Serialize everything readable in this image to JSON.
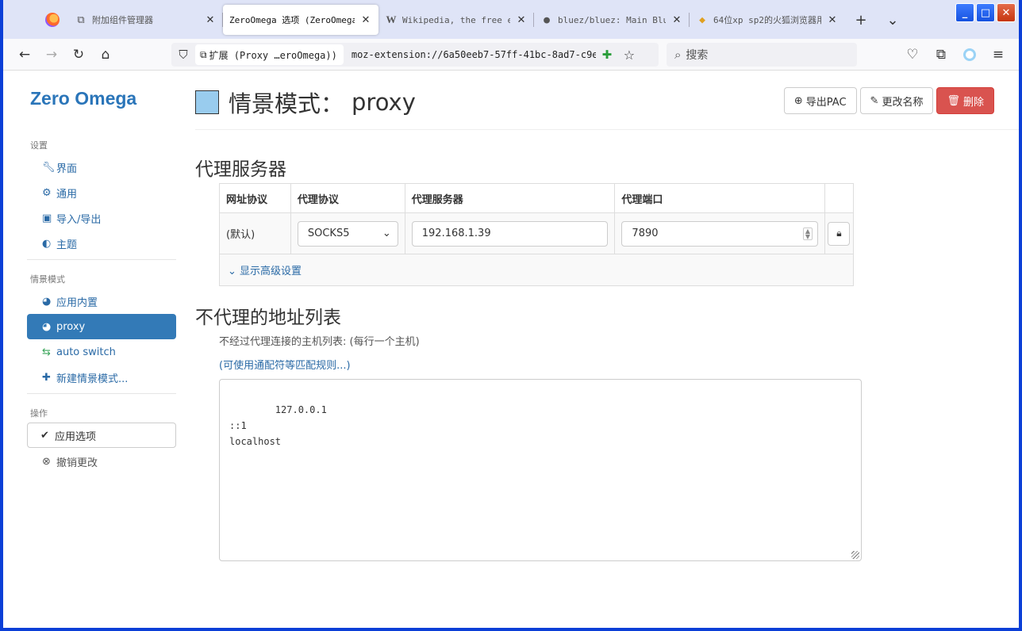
{
  "tabs": [
    {
      "icon": "puzzle-icon",
      "title": "附加组件管理器",
      "active": false
    },
    {
      "icon": "",
      "title": "ZeroOmega 选项 (ZeroOmega)",
      "active": true
    },
    {
      "icon": "wikipedia-icon",
      "title": "Wikipedia, the free enc",
      "active": false
    },
    {
      "icon": "github-icon",
      "title": "bluez/bluez: Main BlueZ",
      "active": false
    },
    {
      "icon": "fox-icon",
      "title": "64位xp sp2的火狐浏览器用",
      "active": false
    }
  ],
  "toolbar": {
    "extension_chip": "扩展 (Proxy …eroOmega))",
    "url": "moz-extension://6a50eeb7-57ff-41bc-8ad7-c9ed",
    "search_placeholder": "搜索"
  },
  "sidebar": {
    "brand": "Zero Omega",
    "section_settings": "设置",
    "settings_items": [
      {
        "icon": "wrench-icon",
        "label": "界面"
      },
      {
        "icon": "gear-icon",
        "label": "通用"
      },
      {
        "icon": "floppy-icon",
        "label": "导入/导出"
      },
      {
        "icon": "contrast-icon",
        "label": "主题"
      }
    ],
    "section_profiles": "情景模式",
    "profile_items": [
      {
        "icon": "globe-icon",
        "label": "应用内置",
        "active": false
      },
      {
        "icon": "globe-icon",
        "label": "proxy",
        "active": true
      },
      {
        "icon": "switch-icon",
        "label": "auto switch",
        "active": false
      },
      {
        "icon": "plus-icon",
        "label": "新建情景模式...",
        "active": false
      }
    ],
    "section_actions": "操作",
    "apply_label": "应用选项",
    "discard_label": "撤销更改"
  },
  "header": {
    "title_prefix": "情景模式：",
    "profile_name": "proxy",
    "export_pac": "导出PAC",
    "rename": "更改名称",
    "delete": "删除"
  },
  "proxy_section": {
    "heading": "代理服务器",
    "columns": [
      "网址协议",
      "代理协议",
      "代理服务器",
      "代理端口"
    ],
    "row": {
      "scheme": "(默认)",
      "protocol": "SOCKS5",
      "server": "192.168.1.39",
      "port": "7890"
    },
    "advanced_link": "显示高级设置"
  },
  "bypass_section": {
    "heading": "不代理的地址列表",
    "hint": "不经过代理连接的主机列表: (每行一个主机)",
    "wildcard_link": "(可使用通配符等匹配规则...)",
    "list_text": "127.0.0.1\n::1\nlocalhost"
  },
  "colors": {
    "profile_color": "#99ccee",
    "accent": "#337ab7",
    "danger": "#d9534f"
  }
}
